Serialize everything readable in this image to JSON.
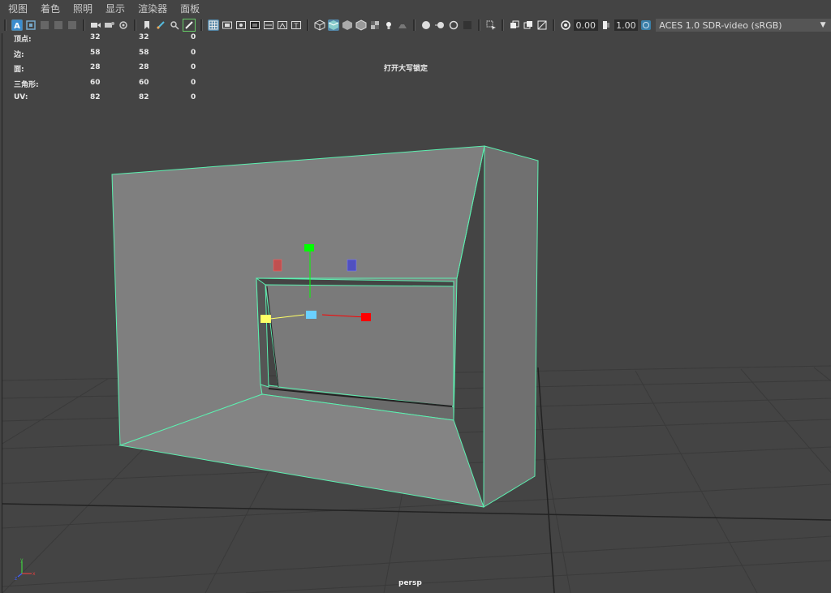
{
  "menubar": {
    "items": [
      "视图",
      "着色",
      "照明",
      "显示",
      "渲染器",
      "面板"
    ]
  },
  "toolbar": {
    "exposure_value": "0.00",
    "gamma_value": "1.00",
    "colorspace": "ACES 1.0 SDR-video (sRGB)",
    "icons": [
      "select-camera-icon",
      "camera-attributes-icon",
      "bookmark-icon",
      "image-plane-icon",
      "2d-pan-zoom-icon",
      "grease-pencil-icon",
      "grid-icon",
      "film-gate-icon",
      "resolution-gate-icon",
      "gate-mask-icon",
      "field-chart-icon",
      "safe-action-icon",
      "safe-title-icon",
      "wireframe-icon",
      "smooth-shade-icon",
      "flat-shade-icon",
      "bounding-box-icon",
      "use-default-material-icon",
      "textured-icon",
      "lights-icon",
      "shadows-icon",
      "screen-space-ao-icon",
      "motion-blur-icon",
      "anti-aliasing-icon",
      "depth-of-field-icon",
      "isolate-select-icon",
      "xray-icon",
      "xray-joints-icon",
      "backface-culling-icon",
      "exposure-icon",
      "gamma-icon",
      "color-management-icon"
    ]
  },
  "hud": {
    "rows": [
      {
        "label": "顶点:",
        "v1": "32",
        "v2": "32",
        "v3": "0"
      },
      {
        "label": "边:",
        "v1": "58",
        "v2": "58",
        "v3": "0"
      },
      {
        "label": "面:",
        "v1": "28",
        "v2": "28",
        "v3": "0"
      },
      {
        "label": "三角形:",
        "v1": "60",
        "v2": "60",
        "v3": "0"
      },
      {
        "label": "UV:",
        "v1": "82",
        "v2": "82",
        "v3": "0"
      }
    ],
    "caps_lock": "打开大写锁定",
    "camera": "persp"
  },
  "axis": {
    "y": "y",
    "z": "z",
    "x": "x"
  },
  "colors": {
    "background": "#444444",
    "grid": "#333333",
    "mesh_fill": "#7f7f7f",
    "selection_wire": "#5cf0b0",
    "manip_x": "#ff0000",
    "manip_y": "#00ff00",
    "manip_z": "#0000ff",
    "manip_center": "#6ad0ff",
    "manip_yellow": "#ffff66"
  }
}
